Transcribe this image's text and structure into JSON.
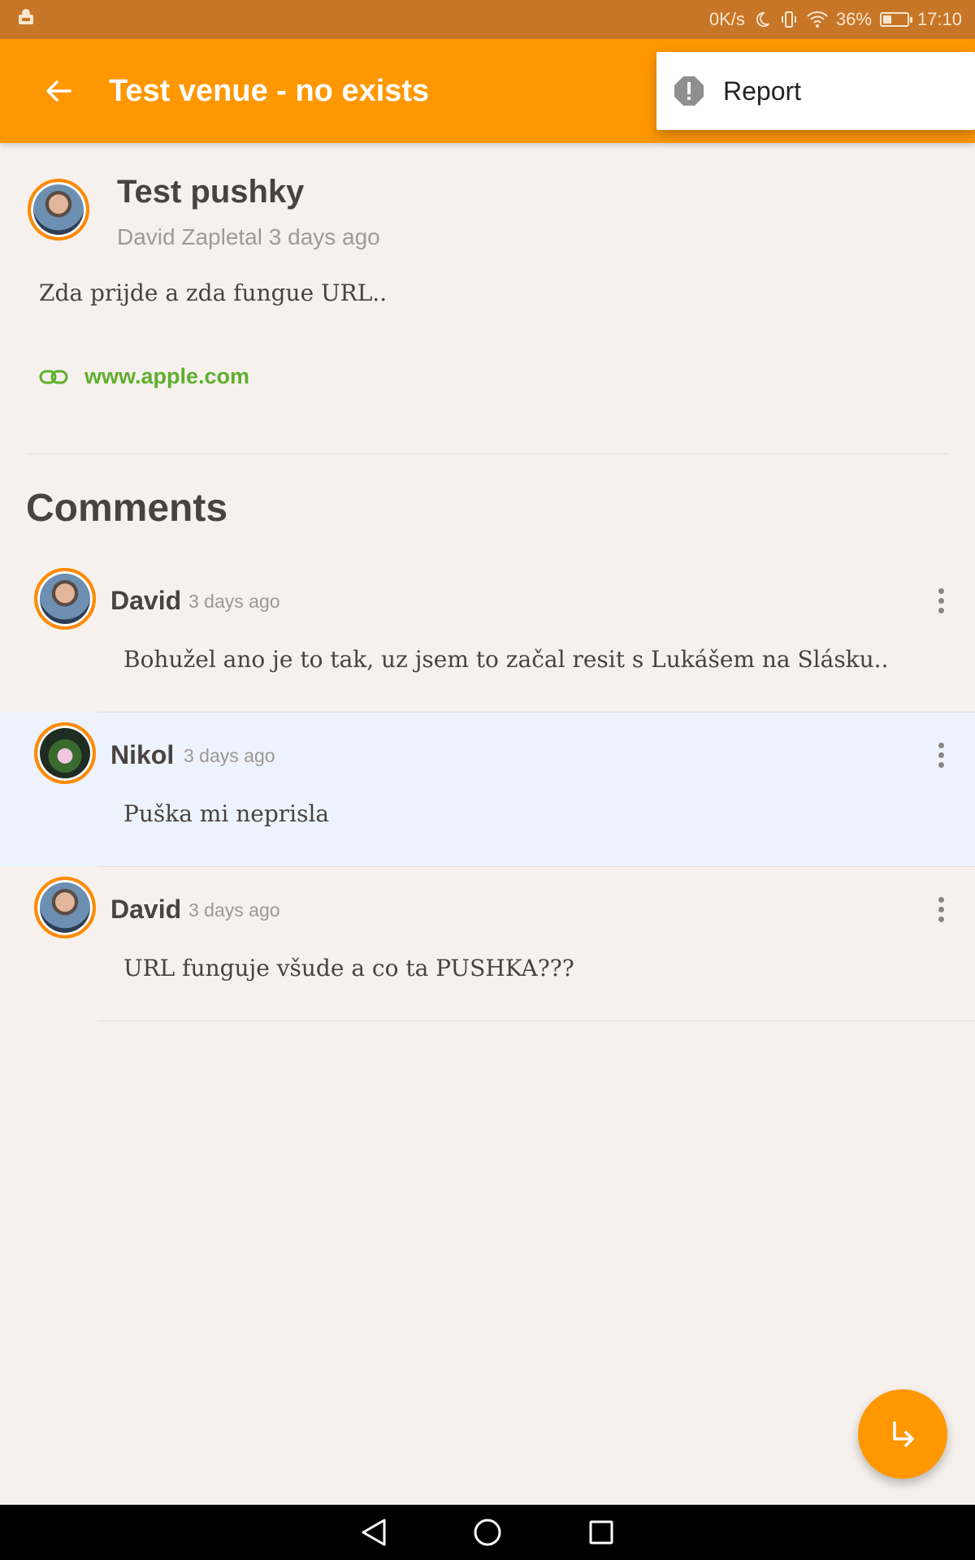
{
  "status_bar": {
    "speed": "0K/s",
    "battery": "36%",
    "battery_fill": 0.36,
    "time": "17:10",
    "icons": [
      "notification-app-icon",
      "moon-icon",
      "vibrate-icon",
      "wifi-icon",
      "battery-icon"
    ]
  },
  "app_bar": {
    "title": "Test venue - no exists",
    "back_icon": "arrow-left-icon",
    "background": "#ff9700"
  },
  "overflow_menu": {
    "items": [
      {
        "label": "Report",
        "icon": "alert-octagon-icon"
      }
    ]
  },
  "post": {
    "title": "Test pushky",
    "author": "David Zapletal",
    "time": "3 days ago",
    "body": "Zda prijde a zda fungue URL..",
    "link": {
      "text": "www.apple.com",
      "icon": "link-icon",
      "color": "#5fae2e"
    }
  },
  "comments": {
    "heading": "Comments",
    "items": [
      {
        "author": "David",
        "time": "3 days ago",
        "text": "Bohužel ano je to tak, uz jsem to začal resit s Lukášem na Slásku..",
        "highlighted": false
      },
      {
        "author": "Nikol",
        "time": "3 days ago",
        "text": "Puška mi neprisla",
        "highlighted": true
      },
      {
        "author": "David",
        "time": "3 days ago",
        "text": "URL funguje všude a co ta PUSHKA???",
        "highlighted": false
      }
    ]
  },
  "fab": {
    "icon": "reply-arrow-icon",
    "color": "#ff9700"
  },
  "nav_bar": {
    "icons": [
      "back-triangle-icon",
      "home-circle-icon",
      "recents-square-icon"
    ]
  }
}
